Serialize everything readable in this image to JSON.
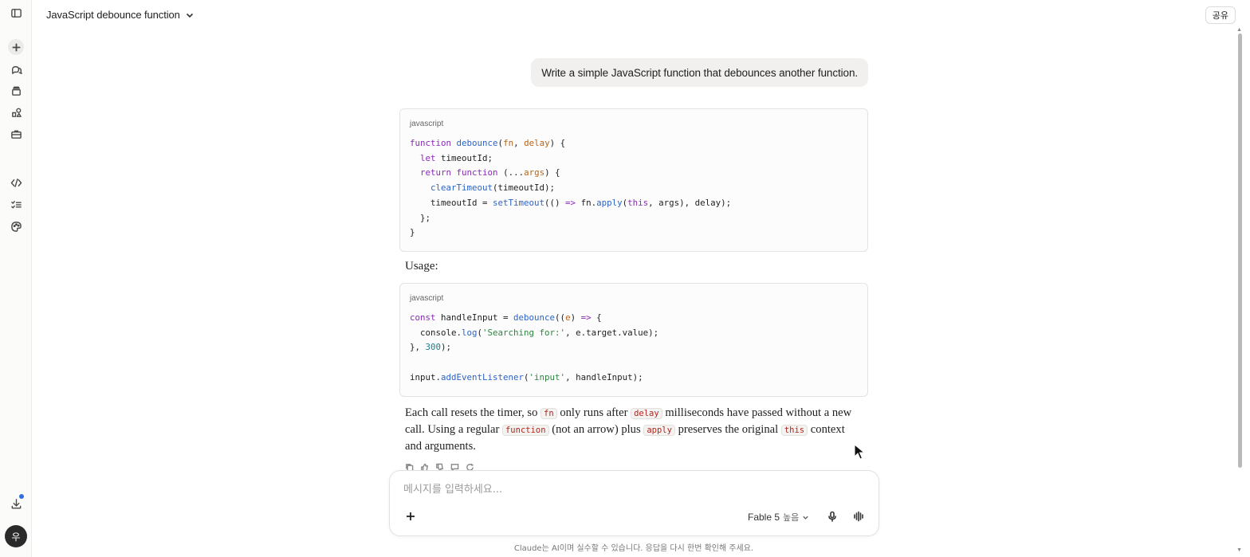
{
  "header": {
    "chat_title": "JavaScript debounce function",
    "share_label": "공유"
  },
  "sidebar": {
    "avatar_initial": "우",
    "items": [
      {
        "name": "toggle-sidebar",
        "icon": "sidebar-panel-icon"
      },
      {
        "name": "new-chat",
        "icon": "plus-icon"
      },
      {
        "name": "chats",
        "icon": "chat-bubbles-icon"
      },
      {
        "name": "projects",
        "icon": "stack-icon"
      },
      {
        "name": "artifacts",
        "icon": "shapes-icon"
      },
      {
        "name": "workspace",
        "icon": "briefcase-icon"
      },
      {
        "name": "code",
        "icon": "code-icon"
      },
      {
        "name": "tasks",
        "icon": "checklist-icon"
      },
      {
        "name": "customize",
        "icon": "palette-icon"
      },
      {
        "name": "download",
        "icon": "download-icon"
      }
    ]
  },
  "conversation": {
    "user_message": "Write a simple JavaScript function that debounces another function.",
    "code_blocks": [
      {
        "language": "javascript",
        "lines": [
          "function debounce(fn, delay) {",
          "  let timeoutId;",
          "  return function (...args) {",
          "    clearTimeout(timeoutId);",
          "    timeoutId = setTimeout(() => fn.apply(this, args), delay);",
          "  };",
          "}"
        ]
      },
      {
        "language": "javascript",
        "lines": [
          "const handleInput = debounce((e) => {",
          "  console.log('Searching for:', e.target.value);",
          "}, 300);",
          "",
          "input.addEventListener('input', handleInput);"
        ]
      }
    ],
    "usage_label": "Usage:",
    "explanation": {
      "t1": "Each call resets the timer, so ",
      "c1": "fn",
      "t2": " only runs after ",
      "c2": "delay",
      "t3": " milliseconds have passed without a new call. Using a regular ",
      "c3": "function",
      "t4": " (not an arrow) plus ",
      "c4": "apply",
      "t5": " preserves the original ",
      "c5": "this",
      "t6": " context and arguments."
    }
  },
  "composer": {
    "placeholder": "메시지를 입력하세요...",
    "model_name": "Fable 5",
    "model_level": "높음"
  },
  "footer": {
    "disclaimer": "Claude는 AI이며 실수할 수 있습니다. 응답을 다시 한번 확인해 주세요."
  },
  "colors": {
    "keyword": "#8a2bb8",
    "function": "#2c63c7",
    "param": "#b5651d",
    "string": "#2e8540",
    "number": "#1a7f8a",
    "inline_code": "#b3261e",
    "notify": "#2f6fe0"
  }
}
